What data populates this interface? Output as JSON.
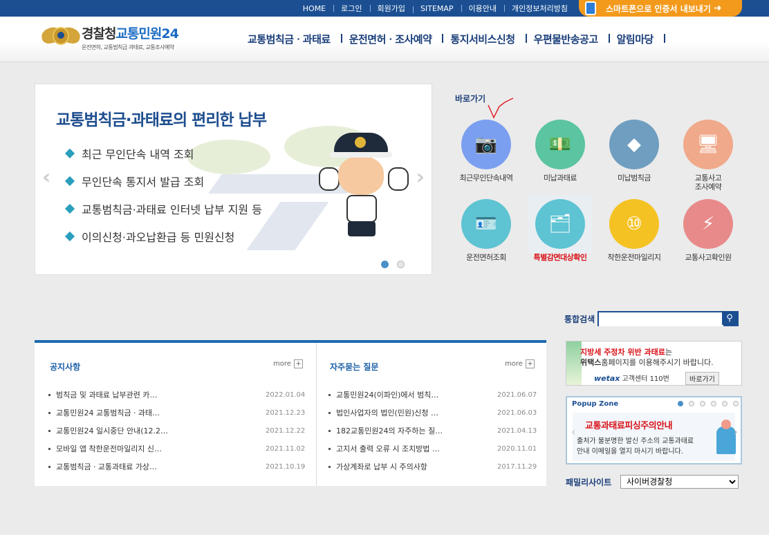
{
  "topbar": {
    "links": [
      "HOME",
      "로그인",
      "회원가입",
      "SITEMAP",
      "이용안내",
      "개인정보처리방침"
    ],
    "smart_button": "스마트폰으로 인증서 내보내기"
  },
  "header": {
    "logo_main": "경찰청",
    "logo_accent": "교통민원24",
    "logo_sub": "운전면허, 교통범칙금 과태료, 교통조사예약",
    "nav": [
      "교통범칙금ㆍ과태료",
      "운전면허ㆍ조사예약",
      "통지서비스신청",
      "우편물반송공고",
      "알림마당"
    ]
  },
  "slider": {
    "title": "교통범칙금·과태료의 편리한 납부",
    "items": [
      "최근 무인단속 내역 조회",
      "무인단속 통지서 발급 조회",
      "교통범칙금·과태료 인터넷 납부 지원 등",
      "이의신청·과오납환급 등 민원신청"
    ],
    "active_slide": 1,
    "slide_count": 2
  },
  "quick": {
    "title": "바로가기",
    "items": [
      {
        "label": "최근무인단속내역",
        "color": "#7b9ff0",
        "icon": "camera-icon"
      },
      {
        "label": "미납과태료",
        "color": "#5bc4a0",
        "icon": "money-icon"
      },
      {
        "label": "미납범칙금",
        "color": "#6f9ec0",
        "icon": "warning-icon"
      },
      {
        "label": "교통사고\n조사예약",
        "color": "#f0a98b",
        "icon": "computer-icon"
      },
      {
        "label": "운전면허조회",
        "color": "#5ec3d2",
        "icon": "license-icon"
      },
      {
        "label": "특별감면대상확인",
        "color": "#5ec3d2",
        "icon": "id-card-icon",
        "highlight": true
      },
      {
        "label": "착한운전마일리지",
        "color": "#f5c223",
        "icon": "mileage-icon"
      },
      {
        "label": "교통사고확인원",
        "color": "#e88a8a",
        "icon": "accident-icon"
      }
    ]
  },
  "search": {
    "label": "통합검색",
    "value": ""
  },
  "notice": {
    "title": "공지사항",
    "more": "more",
    "items": [
      {
        "title": "범칙금 및 과태료 납부관련 카…",
        "date": "2022.01.04"
      },
      {
        "title": "교통민원24 교통범칙금ㆍ과태…",
        "date": "2021.12.23"
      },
      {
        "title": "교통민원24 일시중단 안내(12.2…",
        "date": "2021.12.22"
      },
      {
        "title": "모바일 앱 착한운전마일리지 신…",
        "date": "2021.11.02"
      },
      {
        "title": "교통범칙금ㆍ교통과태료 가상…",
        "date": "2021.10.19"
      }
    ]
  },
  "faq": {
    "title": "자주묻는 질문",
    "more": "more",
    "items": [
      {
        "title": "교통민원24(이파인)에서 범칙…",
        "date": "2021.06.07"
      },
      {
        "title": "법인사업자의 법인(민원)신청 …",
        "date": "2021.06.03"
      },
      {
        "title": "182교통민원24의 자주하는 질…",
        "date": "2021.04.13"
      },
      {
        "title": "고지서 출력 오류 시 조치방법 …",
        "date": "2020.11.01"
      },
      {
        "title": "가상계좌로 납부 시 주의사항",
        "date": "2017.11.29"
      }
    ]
  },
  "banner_wetax": {
    "line1_red": "지방세 주정차 위반 과태료",
    "line1_rest": "는",
    "line2_bold": "위택스",
    "line2_rest": "홈페이지를 이용해주시기 바랍니다.",
    "logo": "wetax",
    "center": "고객센터 110번",
    "go": "바로가기"
  },
  "popup": {
    "title": "Popup Zone",
    "headline": "교통과태료피싱주의안내",
    "line1": "출처가 불분명한 발신 주소의 교통과태료",
    "line2": "안내 이메일을 열지 마시기 바랍니다.",
    "active_dot": 1,
    "dot_count": 6
  },
  "family": {
    "label": "패밀리사이트",
    "selected": "사이버경찰청"
  }
}
